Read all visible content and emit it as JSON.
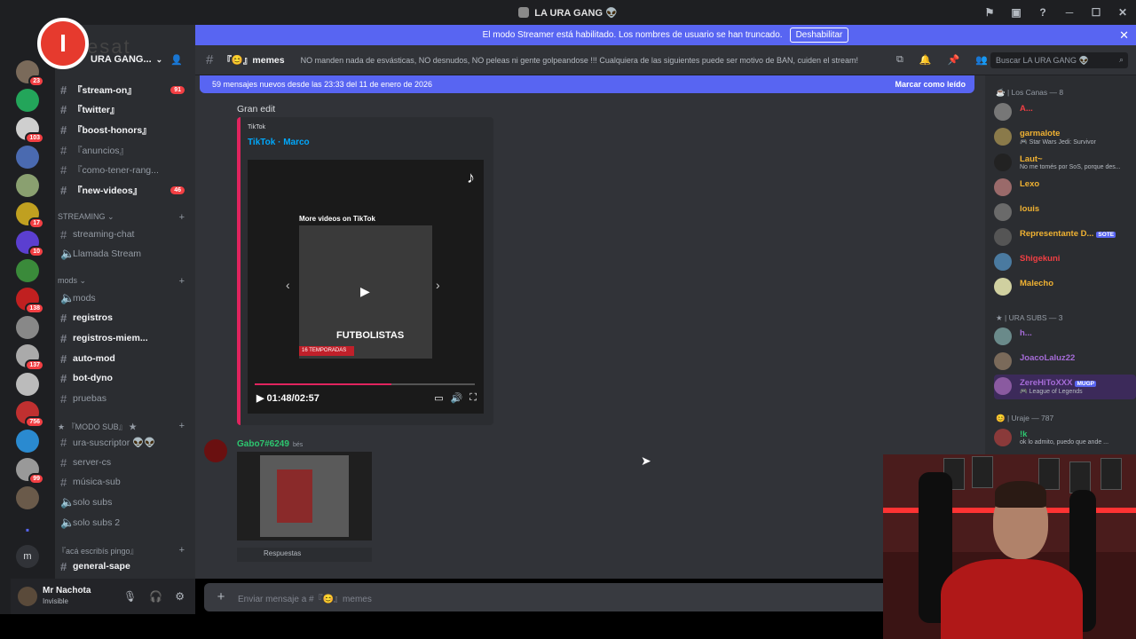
{
  "window": {
    "title": "LA URA GANG 👽"
  },
  "watermark": {
    "letter": "I",
    "text": "esat"
  },
  "streamer_banner": {
    "text": "El modo Streamer está habilitado. Los nombres de usuario se han truncado.",
    "button": "Deshabilitar"
  },
  "server": {
    "name": "URA GANG..."
  },
  "guild_badges": [
    "23",
    "103",
    "17",
    "10",
    "138",
    "137",
    "756",
    "99"
  ],
  "channels": [
    {
      "label": "『stream-on』",
      "unread": true,
      "count": "91"
    },
    {
      "label": "『twitter』",
      "unread": true
    },
    {
      "label": "『boost-honors』",
      "unread": true
    },
    {
      "label": "『anuncios』",
      "unread": false
    },
    {
      "label": "『como-tener-rang...",
      "unread": false
    },
    {
      "label": "『new-videos』",
      "unread": true,
      "count": "46"
    }
  ],
  "categories": {
    "streaming": "STREAMING",
    "mods": "mods",
    "modo_sub": "『MODO SUB』",
    "aca": "『acá escribís pingo』"
  },
  "streaming_channels": [
    "streaming-chat",
    "Llamada Stream"
  ],
  "mods_channels": [
    "mods",
    "registros",
    "registros-miem...",
    "auto-mod",
    "bot-dyno",
    "pruebas"
  ],
  "sub_channels": [
    "ura-suscriptor 👽👽",
    "server-cs",
    "música-sub",
    "solo subs",
    "solo subs 2"
  ],
  "aca_channels": [
    "general-sape"
  ],
  "user": {
    "name": "Mr Nachota",
    "status": "Invisible"
  },
  "channel": {
    "name": "memes",
    "topic": "NO manden nada de esvásticas, NO desnudos, NO peleas ni gente golpeandose !!! Cualquiera de las siguientes puede ser motivo de BAN, cuiden el stream!"
  },
  "search": {
    "placeholder": "Buscar LA URA GANG 👽"
  },
  "new_messages": {
    "text": "59 mensajes nuevos desde las 23:33 del 11 de enero de 2026",
    "action": "Marcar como leído"
  },
  "messages": [
    {
      "text": "Gran edit",
      "embed": {
        "provider": "TikTok",
        "title": "TikTok · Marco",
        "more": "More videos on TikTok",
        "overlay": "FUTBOLISTAS",
        "subtag": "16 TEMPORADAS",
        "time": "01:48/02:57",
        "progress": 0.62
      }
    },
    {
      "author": "Gabo7#6249",
      "time": "bés",
      "reply": "Respuestas"
    }
  ],
  "composer": {
    "placeholder": "Enviar mensaje a #『😊』memes"
  },
  "member_groups": [
    {
      "title": "Los Canas — 8",
      "members": [
        {
          "name": "A...",
          "color": "#f23f43",
          "sub": ""
        },
        {
          "name": "garmalote",
          "color": "#f0b232",
          "sub": "🎮 Star Wars Jedi: Survivor"
        },
        {
          "name": "Laut~",
          "color": "#f0b232",
          "sub": "No me tomés por SoS, porque des..."
        },
        {
          "name": "Lexo",
          "color": "#f0b232",
          "sub": ""
        },
        {
          "name": "louis",
          "color": "#f0b232",
          "sub": ""
        },
        {
          "name": "Representante D...",
          "color": "#f0b232",
          "sub": "",
          "tag": "SOTE"
        },
        {
          "name": "Shigekuni",
          "color": "#f23f43",
          "sub": ""
        },
        {
          "name": "Malecho",
          "color": "#f0b232",
          "sub": ""
        }
      ]
    },
    {
      "title": "URA SUBS — 3",
      "members": [
        {
          "name": "h...",
          "color": "#a66cd8",
          "sub": ""
        },
        {
          "name": "JoacoLaluz22",
          "color": "#a66cd8",
          "sub": ""
        },
        {
          "name": "ZereHiToXXX",
          "color": "#a66cd8",
          "sub": "🎮 League of Legends",
          "tag": "MUGP"
        }
      ]
    },
    {
      "title": "Uraje — 787",
      "members": [
        {
          "name": "!k",
          "color": "#2dc770",
          "sub": "ok lo admito, puedo que ande ..."
        }
      ]
    }
  ]
}
